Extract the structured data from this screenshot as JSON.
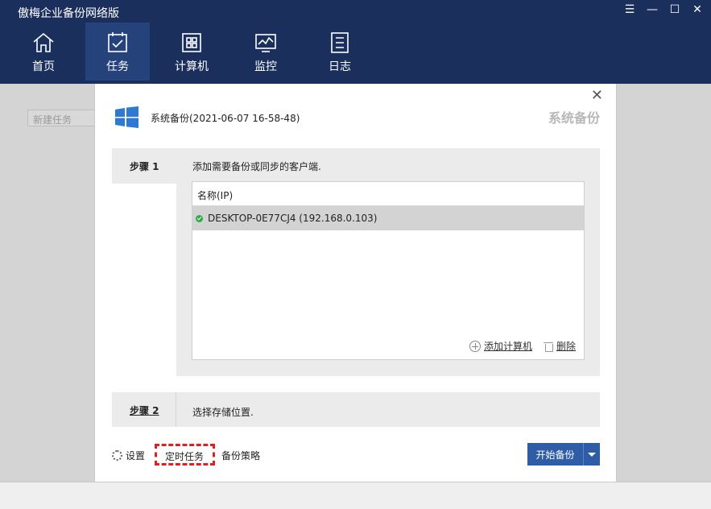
{
  "app": {
    "title": "傲梅企业备份网络版",
    "window_controls": {
      "menu": "☰",
      "minimize": "—",
      "maximize": "☐",
      "close": "✕"
    }
  },
  "nav": {
    "items": [
      {
        "label": "首页",
        "icon": "home-icon"
      },
      {
        "label": "任务",
        "icon": "task-icon",
        "active": true
      },
      {
        "label": "计算机",
        "icon": "computer-icon"
      },
      {
        "label": "监控",
        "icon": "monitor-icon"
      },
      {
        "label": "日志",
        "icon": "log-icon"
      }
    ]
  },
  "left": {
    "new_task_label": "新建任务"
  },
  "dialog": {
    "close": "✕",
    "task_title": "系统备份(2021-06-07 16-58-48)",
    "type_title": "系统备份",
    "step1": {
      "label": "步骤 1",
      "description": "添加需要备份或同步的客户端.",
      "column_header": "名称(IP)",
      "rows": [
        {
          "name": "DESKTOP-0E77CJ4 (192.168.0.103)",
          "status": "online"
        }
      ],
      "add_label": "添加计算机",
      "delete_label": "删除"
    },
    "step2": {
      "label": "步骤 2",
      "description": "选择存储位置."
    },
    "bottom": {
      "settings_label": "设置",
      "schedule_label": "定时任务",
      "strategy_label": "备份策略",
      "start_label": "开始备份"
    }
  },
  "colors": {
    "topbar": "#1b2f5c",
    "nav_active": "#26427a",
    "primary_button": "#2f5ca7",
    "highlight": "#e02020"
  }
}
